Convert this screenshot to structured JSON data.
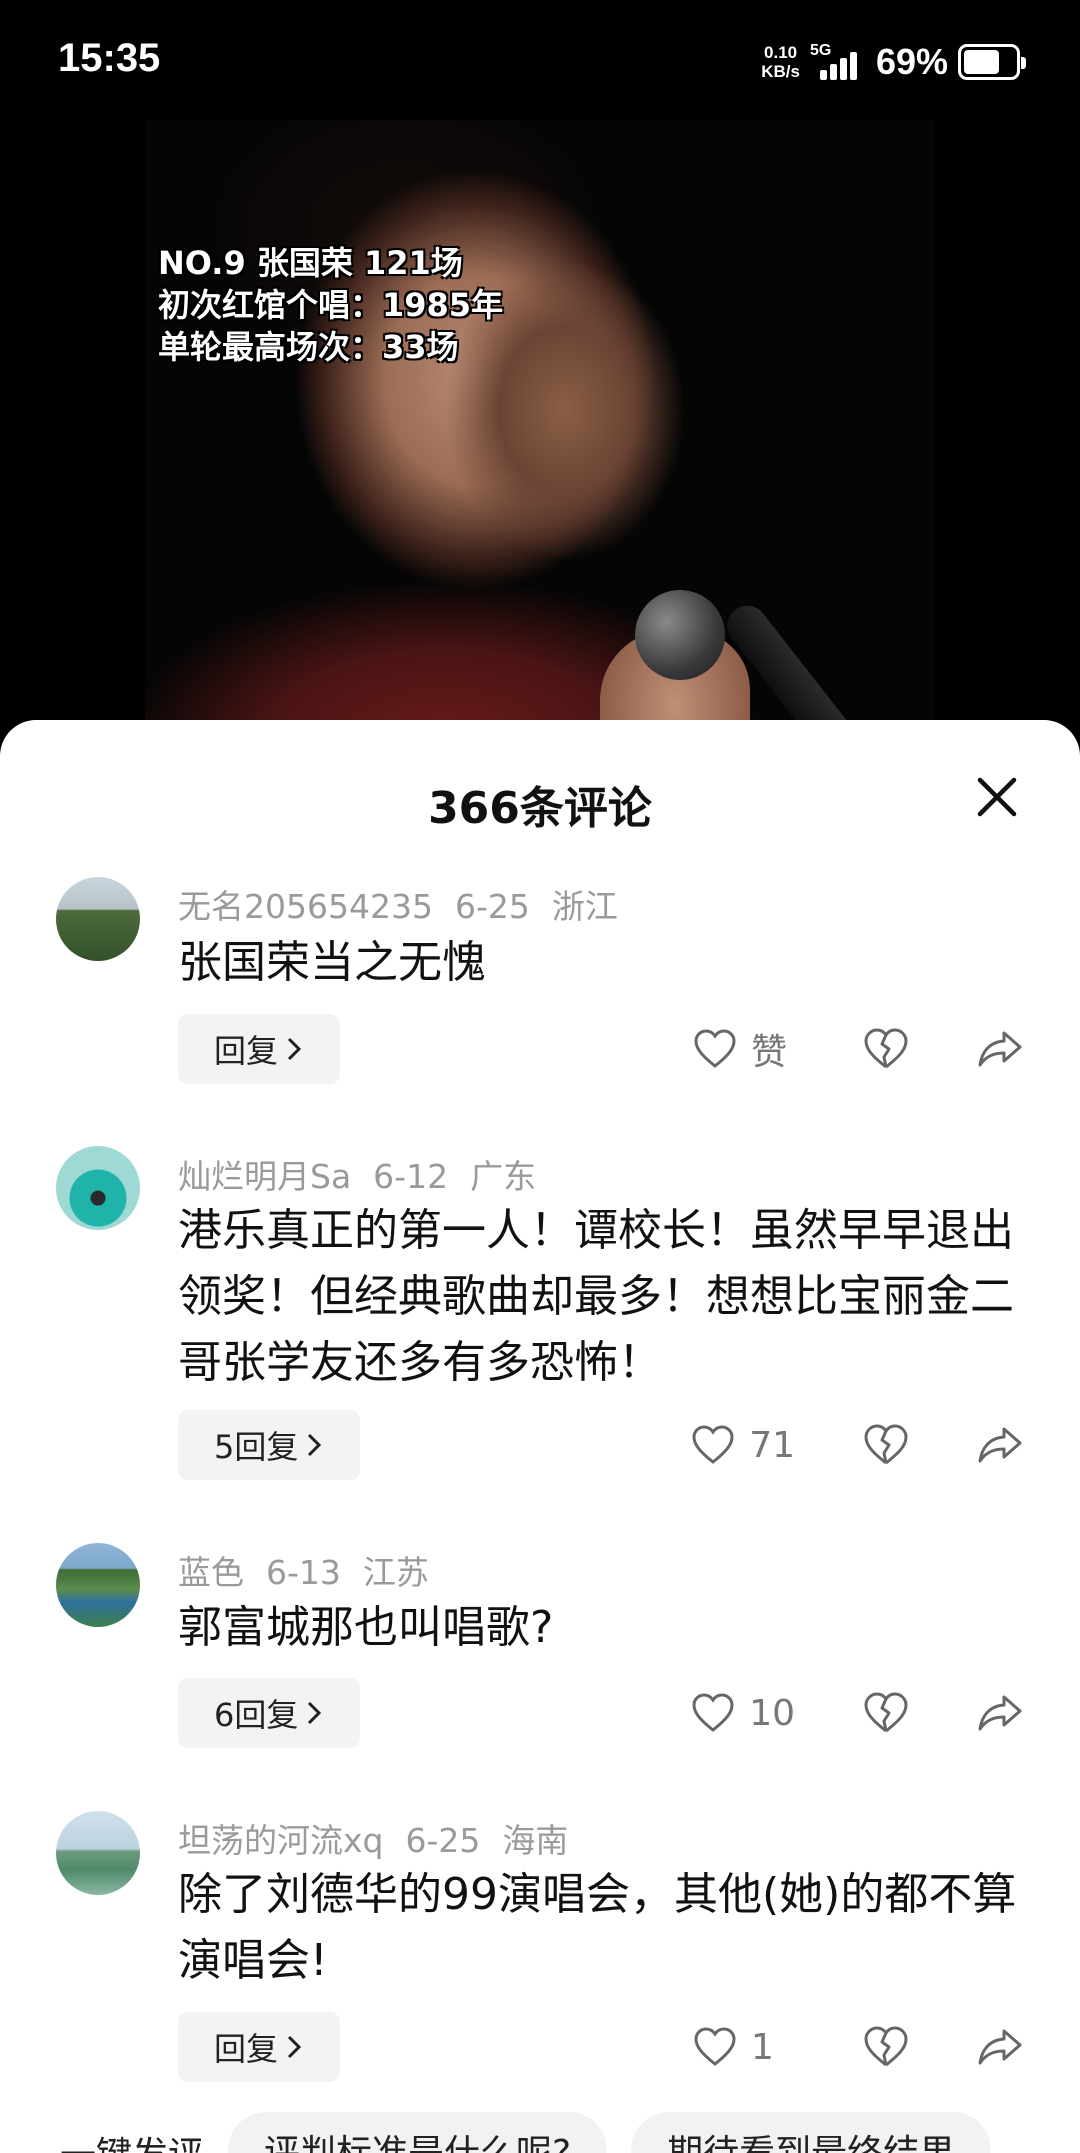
{
  "status_bar": {
    "time": "15:35",
    "net_speed_value": "0.10",
    "net_speed_unit": "KB/s",
    "network_type": "5G",
    "battery_percent": "69%",
    "battery_level": 0.69
  },
  "video": {
    "overlay_lines": [
      "NO.9 张国荣 121场",
      "初次红馆个唱：1985年",
      "单轮最高场次：33场"
    ]
  },
  "comments_panel": {
    "title": "366条评论",
    "comments": [
      {
        "username": "无名205654235",
        "date": "6-25",
        "location": "浙江",
        "text": "张国荣当之无愧",
        "reply_label": "回复",
        "like_label": "赞"
      },
      {
        "username": "灿烂明月Sa",
        "date": "6-12",
        "location": "广东",
        "text": "港乐真正的第一人！谭校长！虽然早早退出领奖！但经典歌曲却最多！想想比宝丽金二哥张学友还多有多恐怖！",
        "reply_label": "5回复",
        "like_label": "71"
      },
      {
        "username": "蓝色",
        "date": "6-13",
        "location": "江苏",
        "text": "郭富城那也叫唱歌?",
        "reply_label": "6回复",
        "like_label": "10"
      },
      {
        "username": "坦荡的河流xq",
        "date": "6-25",
        "location": "海南",
        "text": "除了刘德华的99演唱会，其他(她)的都不算演唱会!",
        "reply_label": "回复",
        "like_label": "1"
      }
    ]
  },
  "quick_comment": {
    "label": "一键发评",
    "suggestions": [
      "评判标准是什么呢?",
      "期待看到最终结果"
    ]
  },
  "colors": {
    "sheet_background": "#ffffff",
    "meta_text": "#9a9a9a",
    "reply_chip": "#f3f3f3"
  }
}
